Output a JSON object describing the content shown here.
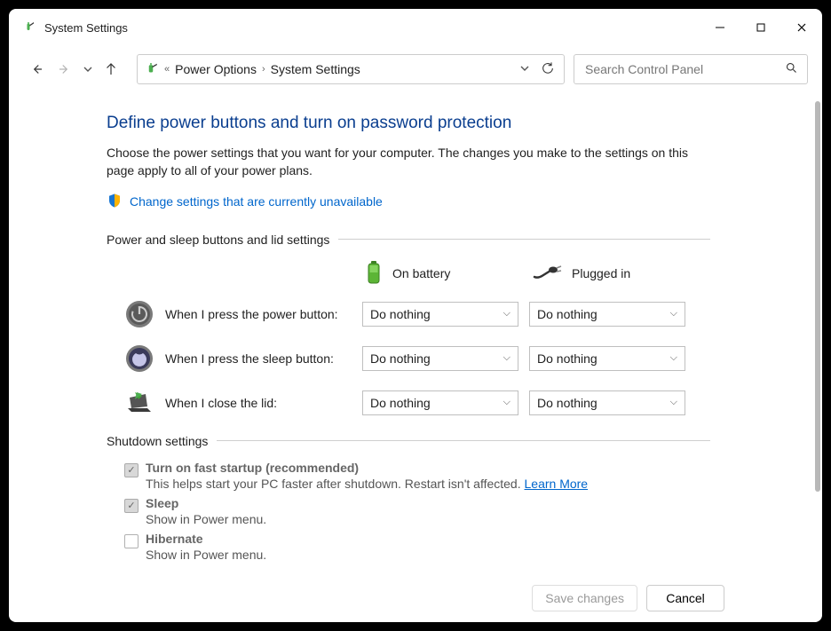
{
  "window": {
    "title": "System Settings"
  },
  "breadcrumbs": {
    "parent": "Power Options",
    "current": "System Settings"
  },
  "search": {
    "placeholder": "Search Control Panel"
  },
  "page": {
    "title": "Define power buttons and turn on password protection",
    "description": "Choose the power settings that you want for your computer. The changes you make to the settings on this page apply to all of your power plans.",
    "change_link": "Change settings that are currently unavailable"
  },
  "section1": {
    "heading": "Power and sleep buttons and lid settings",
    "col_battery": "On battery",
    "col_plugged": "Plugged in",
    "rows": [
      {
        "label": "When I press the power button:",
        "battery": "Do nothing",
        "plugged": "Do nothing"
      },
      {
        "label": "When I press the sleep button:",
        "battery": "Do nothing",
        "plugged": "Do nothing"
      },
      {
        "label": "When I close the lid:",
        "battery": "Do nothing",
        "plugged": "Do nothing"
      }
    ]
  },
  "section2": {
    "heading": "Shutdown settings",
    "items": [
      {
        "title": "Turn on fast startup (recommended)",
        "desc": "This helps start your PC faster after shutdown. Restart isn't affected. ",
        "link": "Learn More"
      },
      {
        "title": "Sleep",
        "desc": "Show in Power menu."
      },
      {
        "title": "Hibernate",
        "desc": "Show in Power menu."
      }
    ]
  },
  "footer": {
    "save": "Save changes",
    "cancel": "Cancel"
  }
}
